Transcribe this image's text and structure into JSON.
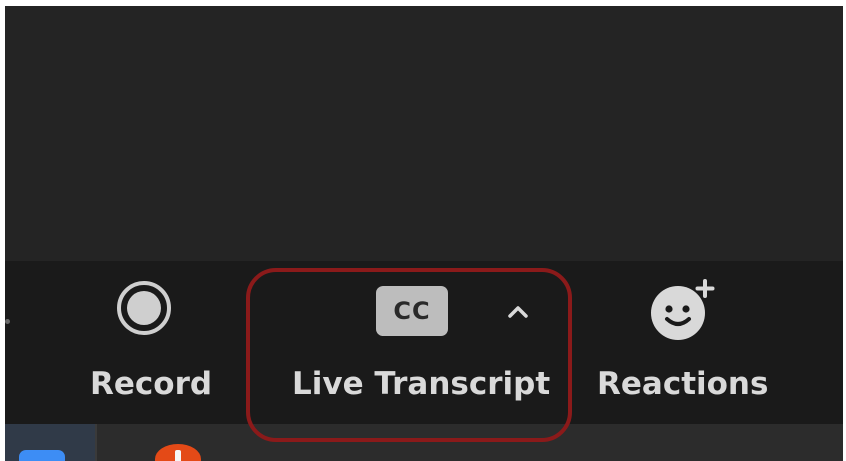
{
  "toolbar": {
    "record_label": "Record",
    "live_transcript_label": "Live Transcript",
    "cc_text": "CC",
    "reactions_label": "Reactions"
  },
  "icons": {
    "record": "record-icon",
    "cc": "closed-captions-icon",
    "chevron": "chevron-up-icon",
    "reactions": "add-reaction-icon"
  },
  "colors": {
    "background": "#242424",
    "toolbar": "#1a1a1a",
    "text": "#d9d9d9",
    "highlight": "#8b1a1a",
    "cc_badge": "#bdbdbd"
  }
}
